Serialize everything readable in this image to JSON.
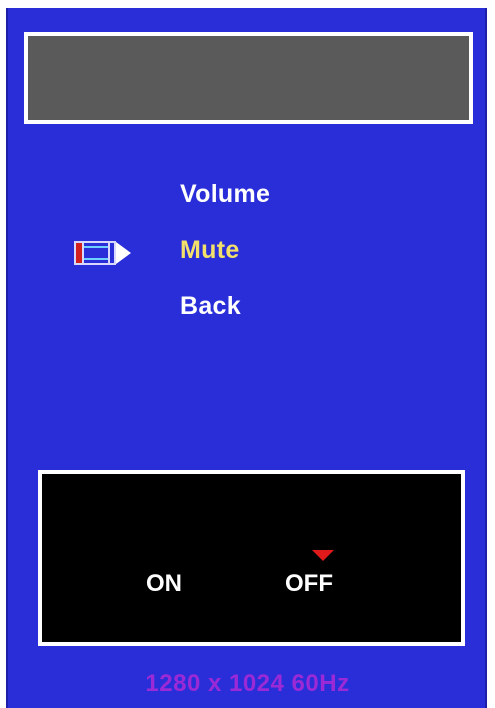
{
  "menu": {
    "items": [
      {
        "label": "Volume",
        "selected": false
      },
      {
        "label": "Mute",
        "selected": true
      },
      {
        "label": "Back",
        "selected": false
      }
    ],
    "cursor_icon": "pencil-pointer-icon"
  },
  "value_box": {
    "options": [
      "ON",
      "OFF"
    ],
    "selected": "OFF"
  },
  "status": {
    "resolution_text": "1280 x 1024  60Hz"
  },
  "colors": {
    "panel_background": "#2a2ed9",
    "title_bar": "#5a5a5a",
    "selected_text": "#f2e06a",
    "marker": "#e01a1a",
    "status_text": "#9b2ad6"
  }
}
